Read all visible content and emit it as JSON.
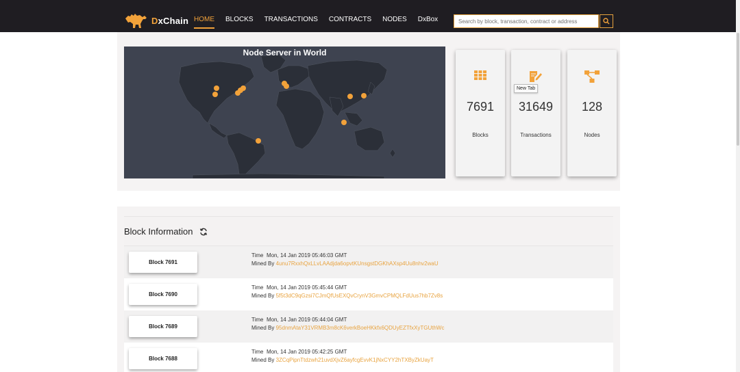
{
  "header": {
    "logo_text_a": "D",
    "logo_text_b": "xChain",
    "nav": [
      {
        "label": "HOME",
        "active": true
      },
      {
        "label": "BLOCKS"
      },
      {
        "label": "TRANSACTIONS"
      },
      {
        "label": "CONTRACTS"
      },
      {
        "label": "NODES"
      },
      {
        "label": "DxBox"
      }
    ],
    "search_placeholder": "Search by block, transaction, contract or address"
  },
  "map": {
    "title": "Node Server in World"
  },
  "stats": [
    {
      "value": "7691",
      "label": "Blocks",
      "icon": "grid-icon"
    },
    {
      "value": "31649",
      "label": "Transactions",
      "icon": "edit-document-icon"
    },
    {
      "value": "128",
      "label": "Nodes",
      "icon": "network-icon"
    }
  ],
  "tooltip": "New Tab",
  "block_info": {
    "title": "Block Information",
    "time_prefix": "Time",
    "mined_prefix": "Mined By",
    "rows": [
      {
        "block": "Block 7691",
        "time": "Mon, 14 Jan 2019 05:46:03 GMT",
        "miner": "4unu7RxxhQxLLvLAAdjda6opvtKUnsgstDGKhAXsp4Uu8nhv2waU"
      },
      {
        "block": "Block 7690",
        "time": "Mon, 14 Jan 2019 05:45:44 GMT",
        "miner": "5f5t3dC9qGzsi7CJmQfUsEXQvCrynV3GmvCPMQLFdUus7hb7Zv8s"
      },
      {
        "block": "Block 7689",
        "time": "Mon, 14 Jan 2019 05:44:04 GMT",
        "miner": "95dnmAtaY31VRMB3m8cK6verkBoeHKkfx6QDUyEZTfxXyTGUthWc"
      },
      {
        "block": "Block 7688",
        "time": "Mon, 14 Jan 2019 05:42:25 GMT",
        "miner": "3ZCqPipnTtdzwh21uvdXjvZ6ayfcgEvvK1jNxCYY2hTXByZkUayT"
      }
    ]
  },
  "colors": {
    "accent": "#f2a23a",
    "header_bg": "#1f1d22",
    "map_bg": "#3e4350"
  }
}
